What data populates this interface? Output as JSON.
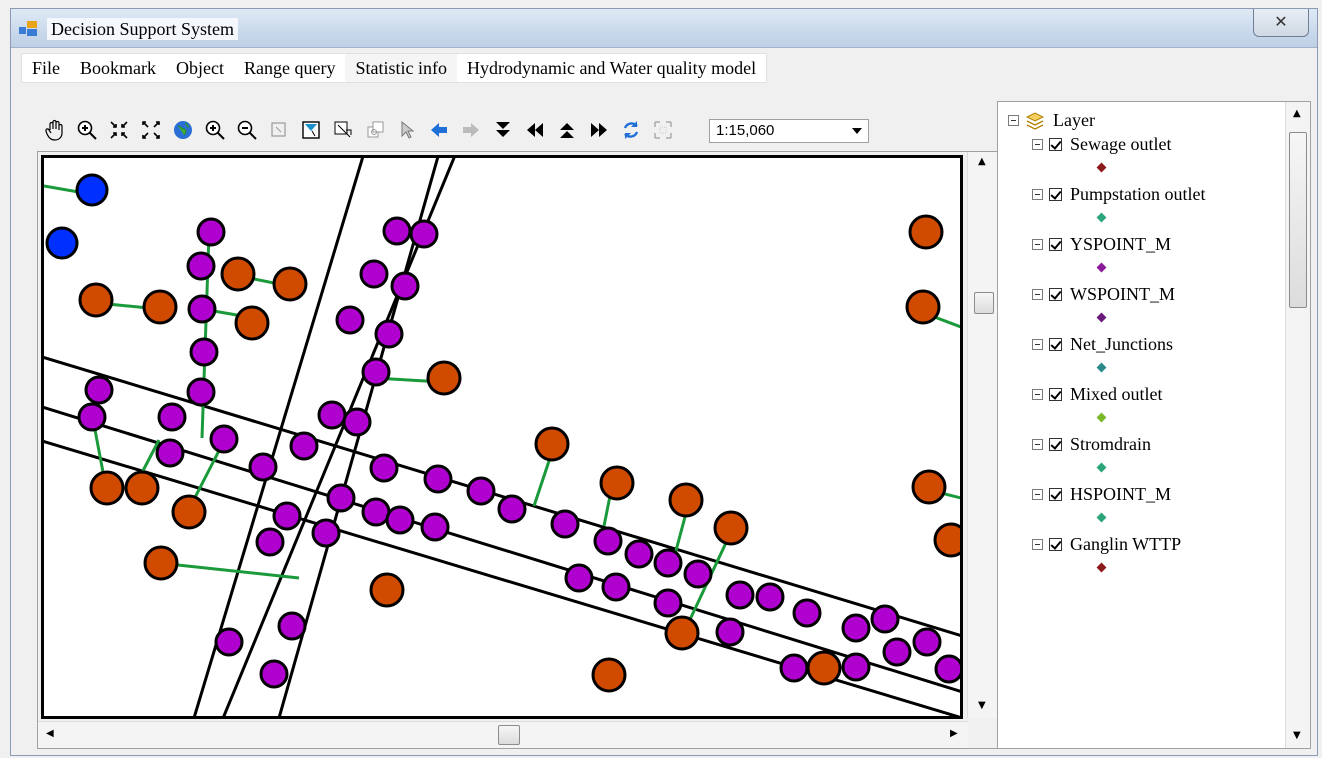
{
  "window": {
    "title": "Decision Support System",
    "close_label": "✕"
  },
  "menu": [
    {
      "label": "File"
    },
    {
      "label": "Bookmark"
    },
    {
      "label": "Object"
    },
    {
      "label": "Range query"
    },
    {
      "label": "Statistic info"
    },
    {
      "label": "Hydrodynamic and Water quality model"
    }
  ],
  "toolbar": {
    "buttons": [
      "pan-icon",
      "zoom-in-glass-icon",
      "zoom-in-fixed-icon",
      "zoom-out-fixed-icon",
      "globe-icon",
      "zoom-in-icon",
      "zoom-out-icon",
      "select-box-icon",
      "select-feature-icon",
      "identify-icon",
      "hyperlink-icon",
      "pointer-icon",
      "back-icon",
      "forward-icon",
      "down-icon",
      "left-icon",
      "up-icon",
      "right-icon",
      "refresh-icon",
      "full-extent-icon"
    ],
    "scale": "1:15,060"
  },
  "toc": {
    "root": "Layer",
    "layers": [
      {
        "name": "Sewage outlet",
        "color": "#8b1a1a"
      },
      {
        "name": "Pumpstation outlet",
        "color": "#2aa67a"
      },
      {
        "name": "YSPOINT_M",
        "color": "#8b1a9b"
      },
      {
        "name": "WSPOINT_M",
        "color": "#6a1a7a"
      },
      {
        "name": "Net_Junctions",
        "color": "#2a8a8a"
      },
      {
        "name": "Mixed outlet",
        "color": "#7ab82a"
      },
      {
        "name": "Stromdrain",
        "color": "#2aa67a"
      },
      {
        "name": "HSPOINT_M",
        "color": "#2aa67a"
      },
      {
        "name": "Ganglin WTTP",
        "color": "#8b1a1a"
      }
    ]
  },
  "colors": {
    "purple": "#b000d0",
    "orange": "#d04a00",
    "blue": "#0030ff",
    "pipe": "#1a9a3a"
  }
}
